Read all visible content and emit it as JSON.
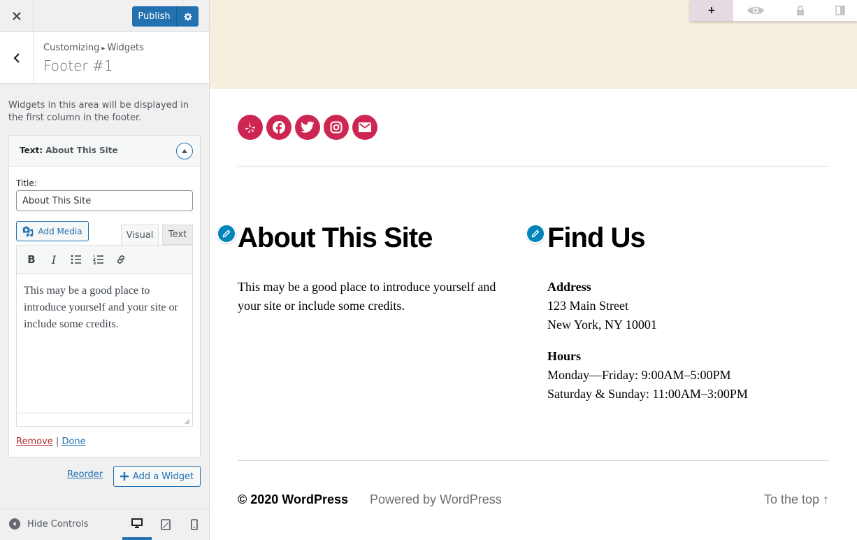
{
  "header": {
    "publish_label": "Publish"
  },
  "section": {
    "breadcrumb_root": "Customizing",
    "breadcrumb_sep": "▸",
    "breadcrumb_current": "Widgets",
    "title": "Footer #1"
  },
  "area_description": "Widgets in this area will be displayed in the first column in the footer.",
  "widget": {
    "type_label": "Text",
    "type_sep": ":",
    "name": "About This Site",
    "title_label": "Title:",
    "title_value": "About This Site",
    "add_media_label": "Add Media",
    "tab_visual": "Visual",
    "tab_text": "Text",
    "toolbar": {
      "bold": "B",
      "italic": "I"
    },
    "content": "This may be a good place to introduce yourself and your site or include some credits.",
    "remove_label": "Remove",
    "separator": "|",
    "done_label": "Done"
  },
  "reorder_label": "Reorder",
  "add_widget_label": "Add a Widget",
  "footer_controls": {
    "hide_controls_label": "Hide Controls"
  },
  "preview": {
    "toolbar_plus": "+",
    "social_icons": [
      "yelp-icon",
      "facebook-icon",
      "twitter-icon",
      "instagram-icon",
      "mail-icon"
    ],
    "about": {
      "heading": "About This Site",
      "text": "This may be a good place to introduce yourself and your site or include some credits."
    },
    "find_us": {
      "heading": "Find Us",
      "address_label": "Address",
      "address_line1": "123 Main Street",
      "address_line2": "New York, NY 10001",
      "hours_label": "Hours",
      "hours_line1": "Monday—Friday: 9:00AM–5:00PM",
      "hours_line2": "Saturday & Sunday: 11:00AM–3:00PM"
    },
    "copyright": "© 2020 WordPress",
    "powered_by": "Powered by WordPress",
    "to_top": "To the top ↑"
  },
  "colors": {
    "accent": "#2271b1",
    "theme_accent": "#cd2653",
    "header_bg": "#f5efe0",
    "edit_shortcut": "#0085ba",
    "remove": "#b32d2e"
  }
}
